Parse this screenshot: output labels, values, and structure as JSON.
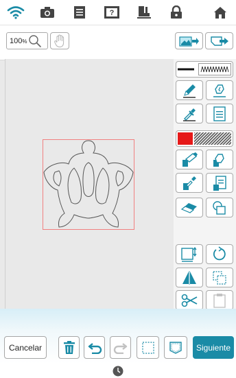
{
  "top_bar": {
    "icons": [
      "wifi-icon",
      "camera-icon",
      "document-icon",
      "help-icon",
      "machine-icon",
      "lock-icon",
      "home-icon"
    ]
  },
  "toolbar": {
    "zoom_value": "100",
    "zoom_unit": "%"
  },
  "right_panel": {
    "line_swatch_color": "#000000",
    "fill_swatch_color": "#e61919",
    "tools": [
      "line-type",
      "zigzag-stitch",
      "pen",
      "eraser-fill",
      "line-eyedropper",
      "line-properties",
      "fill-color",
      "fill-pattern",
      "fill-bucket",
      "fill-eraser",
      "fill-eyedropper",
      "fill-properties",
      "eraser",
      "select-shape",
      "resize",
      "rotate",
      "flip",
      "duplicate",
      "cut",
      "paste"
    ]
  },
  "bottom_bar": {
    "cancel_label": "Cancelar",
    "next_label": "Siguiente",
    "accent_color": "#1a8ba6"
  },
  "canvas": {
    "object": "turtle-outline",
    "selection_color": "#f08080"
  }
}
